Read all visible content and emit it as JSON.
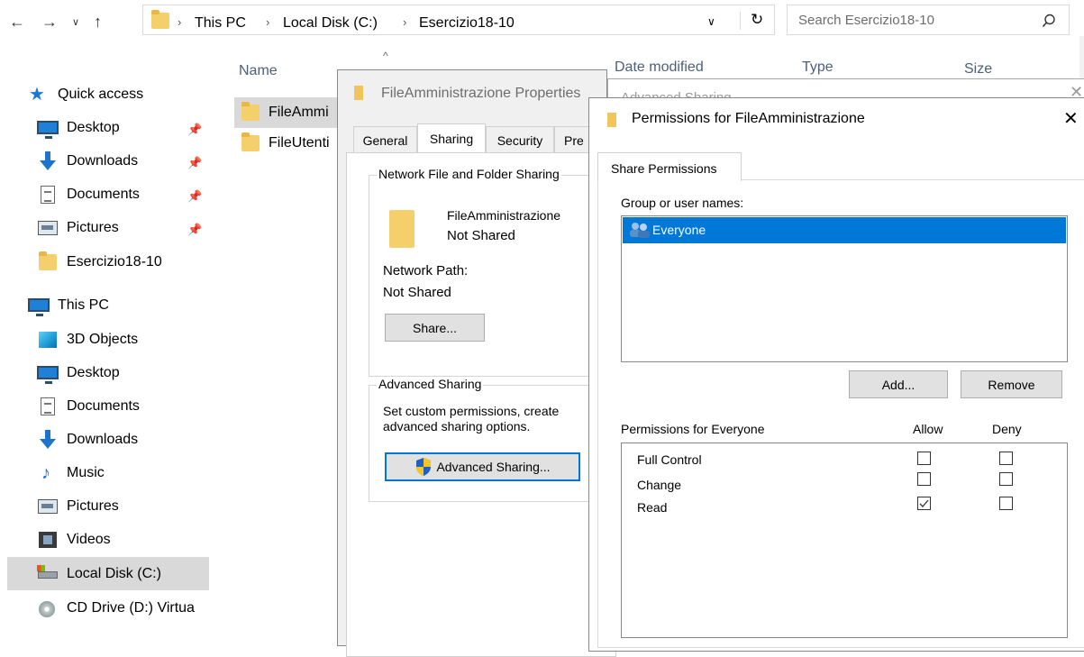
{
  "explorer": {
    "breadcrumb": [
      "This PC",
      "Local Disk (C:)",
      "Esercizio18-10"
    ],
    "search_placeholder": "Search Esercizio18-10",
    "columns": {
      "name": "Name",
      "date": "Date modified",
      "type": "Type",
      "size": "Size"
    },
    "files": [
      "FileAmmi",
      "FileUtenti"
    ]
  },
  "sidebar": {
    "quick_access": "Quick access",
    "quick_items": [
      "Desktop",
      "Downloads",
      "Documents",
      "Pictures",
      "Esercizio18-10"
    ],
    "this_pc": "This PC",
    "pc_items": [
      "3D Objects",
      "Desktop",
      "Documents",
      "Downloads",
      "Music",
      "Pictures",
      "Videos",
      "Local Disk (C:)",
      "CD Drive (D:) Virtua"
    ]
  },
  "properties": {
    "title": "FileAmministrazione Properties",
    "tabs": [
      "General",
      "Sharing",
      "Security",
      "Pre"
    ],
    "network_group_title": "Network File and Folder Sharing",
    "folder_name": "FileAmministrazione",
    "share_status": "Not Shared",
    "network_path_label": "Network Path:",
    "network_path_value": "Not Shared",
    "share_button": "Share...",
    "advanced_group_title": "Advanced Sharing",
    "advanced_desc_line1": "Set custom permissions, create",
    "advanced_desc_line2": "advanced sharing options.",
    "advanced_button": "Advanced Sharing..."
  },
  "advanced_sharing": {
    "title": "Advanced Sharing"
  },
  "permissions": {
    "title": "Permissions for FileAmministrazione",
    "tab": "Share Permissions",
    "group_label": "Group or user names:",
    "users": [
      "Everyone"
    ],
    "add_button": "Add...",
    "remove_button": "Remove",
    "perm_for": "Permissions for Everyone",
    "allow": "Allow",
    "deny": "Deny",
    "rows": [
      {
        "name": "Full Control",
        "allow": false,
        "deny": false
      },
      {
        "name": "Change",
        "allow": false,
        "deny": false
      },
      {
        "name": "Read",
        "allow": true,
        "deny": false
      }
    ],
    "selection_color": "#0078d7"
  }
}
